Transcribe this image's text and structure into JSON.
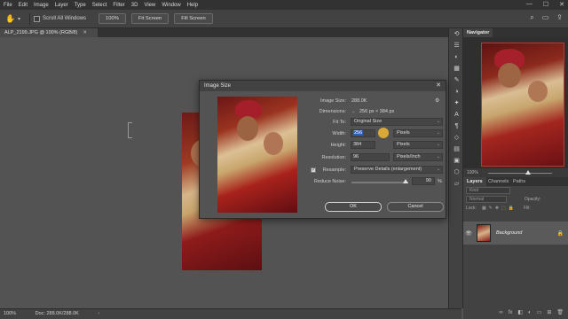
{
  "menu": [
    "File",
    "Edit",
    "Image",
    "Layer",
    "Type",
    "Select",
    "Filter",
    "3D",
    "View",
    "Window",
    "Help"
  ],
  "window_controls": [
    "—",
    "☐",
    "✕"
  ],
  "options": {
    "scroll_all_windows": "Scroll All Windows",
    "zoom_100": "100%",
    "fit_screen": "Fit Screen",
    "fill_screen": "Fill Screen"
  },
  "document": {
    "tab_title": "ALP_2199.JPG @ 100% (RGB/8)"
  },
  "status": {
    "zoom": "100%",
    "doc": "Doc: 288.0K/288.0K"
  },
  "panels": {
    "navigator": "Navigator",
    "nav_zoom": "100%",
    "layers_tabs": [
      "Layers",
      "Channels",
      "Paths"
    ],
    "kind": "Kind",
    "blend_mode": "Normal",
    "opacity_label": "Opacity:",
    "lock_label": "Lock:",
    "fill_label": "Fill:",
    "layer_name": "Background"
  },
  "dialog": {
    "title": "Image Size",
    "image_size_label": "Image Size:",
    "image_size_value": "288.0K",
    "dimensions_label": "Dimensions:",
    "dimensions_value": "256 px  ×  384 px",
    "fit_to_label": "Fit To:",
    "fit_to_value": "Original Size",
    "width_label": "Width:",
    "width_value": "256",
    "width_unit": "Pixels",
    "height_label": "Height:",
    "height_value": "384",
    "height_unit": "Pixels",
    "resolution_label": "Resolution:",
    "resolution_value": "96",
    "resolution_unit": "Pixels/Inch",
    "resample_label": "Resample:",
    "resample_value": "Preserve Details (enlargement)",
    "reduce_noise_label": "Reduce Noise:",
    "reduce_noise_value": "90",
    "reduce_noise_unit": "%",
    "ok": "OK",
    "cancel": "Cancel"
  }
}
